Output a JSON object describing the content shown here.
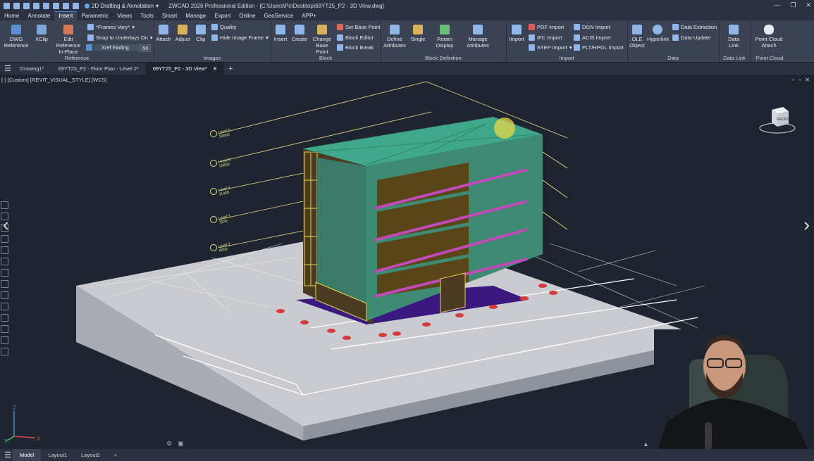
{
  "window": {
    "workspace": "2D Drafting & Annotation",
    "title": "ZWCAD 2026 Professional Edition - [C:\\Users\\Pc\\Desktop\\69YT25_P2 - 3D View.dwg]"
  },
  "menu": [
    "Home",
    "Annotate",
    "Insert",
    "Parametric",
    "Views",
    "Tools",
    "Smart",
    "Manage",
    "Export",
    "Online",
    "GeoService",
    "APP+"
  ],
  "menu_active": "Insert",
  "ribbon": {
    "reference": {
      "label": "Reference",
      "dwg_ref": "DWG\nReference",
      "xclip": "XClip",
      "edit_ref": "Edit Reference\nIn-Place",
      "frames": "*Frames Vary*",
      "snap": "Snap to Underlays On",
      "xref_fading": "Xref Fading",
      "xref_value": "50"
    },
    "images": {
      "label": "Images",
      "attach": "Attach",
      "adjust": "Adjust",
      "clip": "Clip",
      "quality": "Quality",
      "hide_frame": "Hide Image Frame"
    },
    "block": {
      "label": "Block",
      "insert": "Insert",
      "create": "Create",
      "change_base": "Change\nBase Point",
      "set_base": "Set Base Point",
      "block_editor": "Block Editor",
      "block_break": "Block Break"
    },
    "block_def": {
      "label": "Block Definition",
      "define_attr": "Define\nAttributes",
      "single": "Single",
      "retain_display": "Retain Display",
      "manage_attr": "Manage\nAttributes"
    },
    "import": {
      "label": "Import",
      "import": "Import",
      "pdf": "PDF Import",
      "ifc": "IFC Import",
      "step": "STEP Import",
      "dgn": "DGN Import",
      "acis": "ACIS Import",
      "plt": "PLT/HPGL Import"
    },
    "data": {
      "label": "Data",
      "ole": "OLE\nObject",
      "hyperlink": "Hyperlink",
      "extraction": "Data Extraction",
      "update": "Data Update"
    },
    "datalink": {
      "label": "Data Link",
      "link": "Data\nLink"
    },
    "pointcloud": {
      "label": "Point Cloud",
      "attach": "Point Cloud\nAttach"
    }
  },
  "doc_tabs": [
    "Drawing1*",
    "69YT25_P2 - Floor Plan - Level 2*",
    "69YT25_P2 - 3D View*"
  ],
  "doc_tab_active": 2,
  "viewport": {
    "label": "[-] [Custom] [REVIT_VISUAL_STYLE] [WCS]",
    "cube_face": "FRONT"
  },
  "levels": [
    {
      "name": "Level 6",
      "elev": "19600"
    },
    {
      "name": "Level 5",
      "elev": "15800"
    },
    {
      "name": "Level 4",
      "elev": "11400"
    },
    {
      "name": "Level 3",
      "elev": "7200"
    },
    {
      "name": "Level 2",
      "elev": "4000"
    }
  ],
  "ucs": {
    "x": "X",
    "y": "Y",
    "z": "Z"
  },
  "layout_tabs": [
    "Model",
    "Layout1",
    "Layout2"
  ],
  "layout_active": 0,
  "colors": {
    "accent": "#4a8fd6",
    "building": "#3f8a72",
    "roof": "#3fa88a",
    "floor_band": "#c04ab8",
    "glass_frame": "#e6d84a",
    "ground": "#c9cbd0"
  }
}
